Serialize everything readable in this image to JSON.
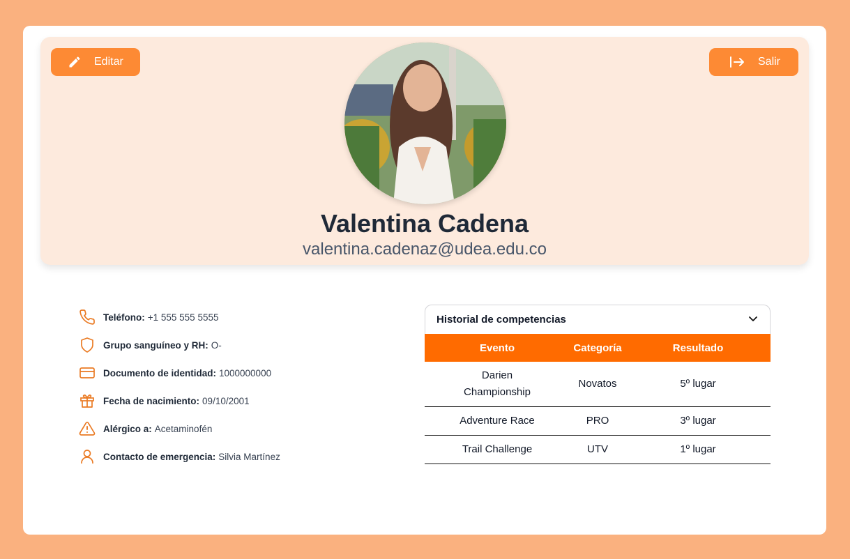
{
  "colors": {
    "page_bg": "#fab17f",
    "accent": "#fd8a34",
    "table_header": "#ff6b00",
    "header_bg": "#fdeadd"
  },
  "header": {
    "edit_label": "Editar",
    "exit_label": "Salir",
    "name": "Valentina Cadena",
    "email": "valentina.cadenaz@udea.edu.co"
  },
  "info": [
    {
      "icon": "phone-icon",
      "key": "Teléfono:",
      "value": "+1 555 555 5555"
    },
    {
      "icon": "shield-icon",
      "key": "Grupo sanguíneo y RH:",
      "value": "O-"
    },
    {
      "icon": "id-card-icon",
      "key": "Documento de identidad:",
      "value": "1000000000"
    },
    {
      "icon": "gift-icon",
      "key": "Fecha de nacimiento:",
      "value": "09/10/2001"
    },
    {
      "icon": "warning-icon",
      "key": "Alérgico a:",
      "value": "Acetaminofén"
    },
    {
      "icon": "user-icon",
      "key": "Contacto de emergencia:",
      "value": "Silvia Martínez"
    }
  ],
  "history": {
    "title": "Historial de competencias",
    "columns": [
      "Evento",
      "Categoría",
      "Resultado"
    ],
    "rows": [
      [
        "Darien Championship",
        "Novatos",
        "5º lugar"
      ],
      [
        "Adventure Race",
        "PRO",
        "3º lugar"
      ],
      [
        "Trail Challenge",
        "UTV",
        "1º lugar"
      ]
    ]
  }
}
